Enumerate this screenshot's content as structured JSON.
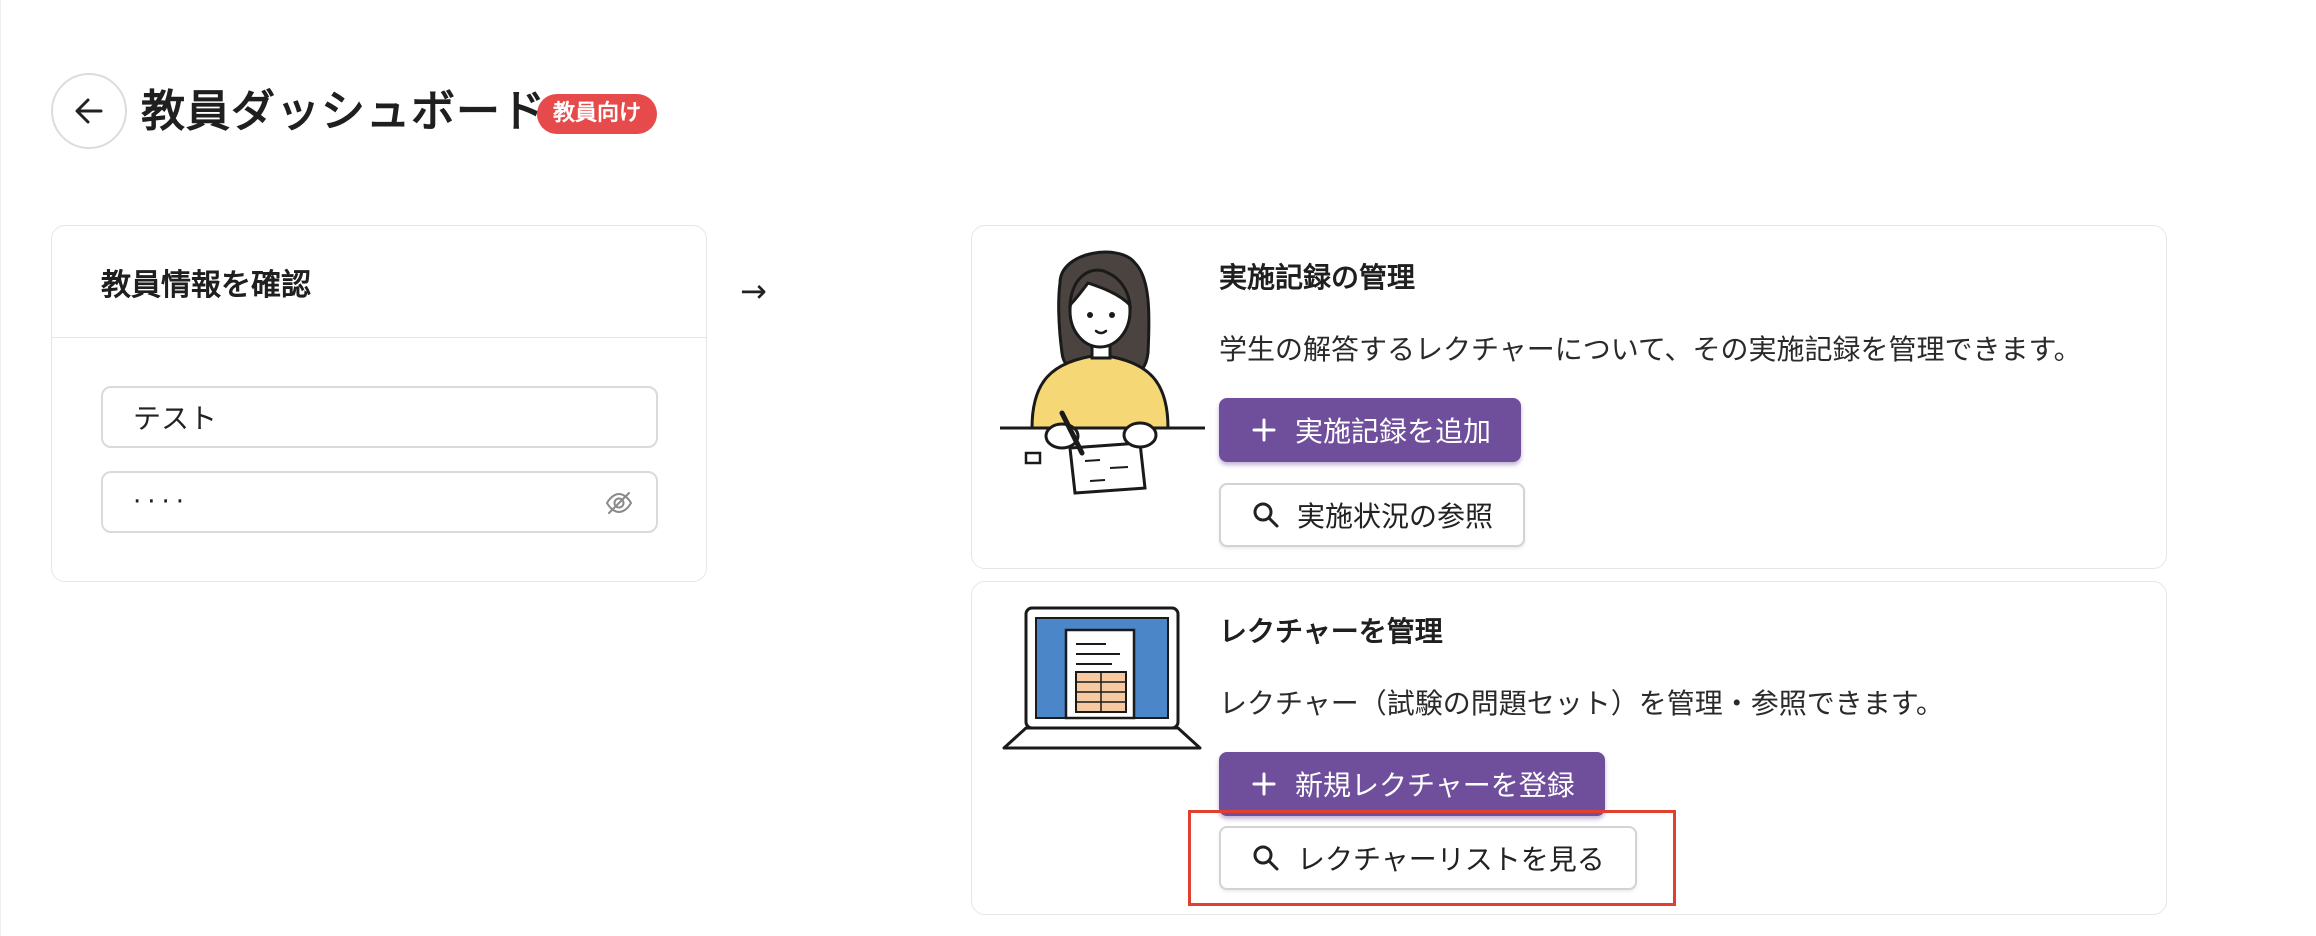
{
  "header": {
    "title": "教員ダッシュボード",
    "badge": "教員向け"
  },
  "info_card": {
    "title": "教員情報を確認",
    "name_value": "テスト",
    "password_value": "····"
  },
  "flow_arrow": "→",
  "records_card": {
    "title": "実施記録の管理",
    "description": "学生の解答するレクチャーについて、その実施記録を管理できます。",
    "add_button": "実施記録を追加",
    "view_button": "実施状況の参照"
  },
  "lectures_card": {
    "title": "レクチャーを管理",
    "description": "レクチャー（試験の問題セット）を管理・参照できます。",
    "register_button": "新規レクチャーを登録",
    "list_button": "レクチャーリストを見る"
  },
  "colors": {
    "primary": "#6f4f9c",
    "badge": "#e64a4a",
    "highlight": "#e0402f"
  },
  "icons": [
    "back-arrow-icon",
    "eye-off-icon",
    "plus-icon",
    "search-icon"
  ]
}
